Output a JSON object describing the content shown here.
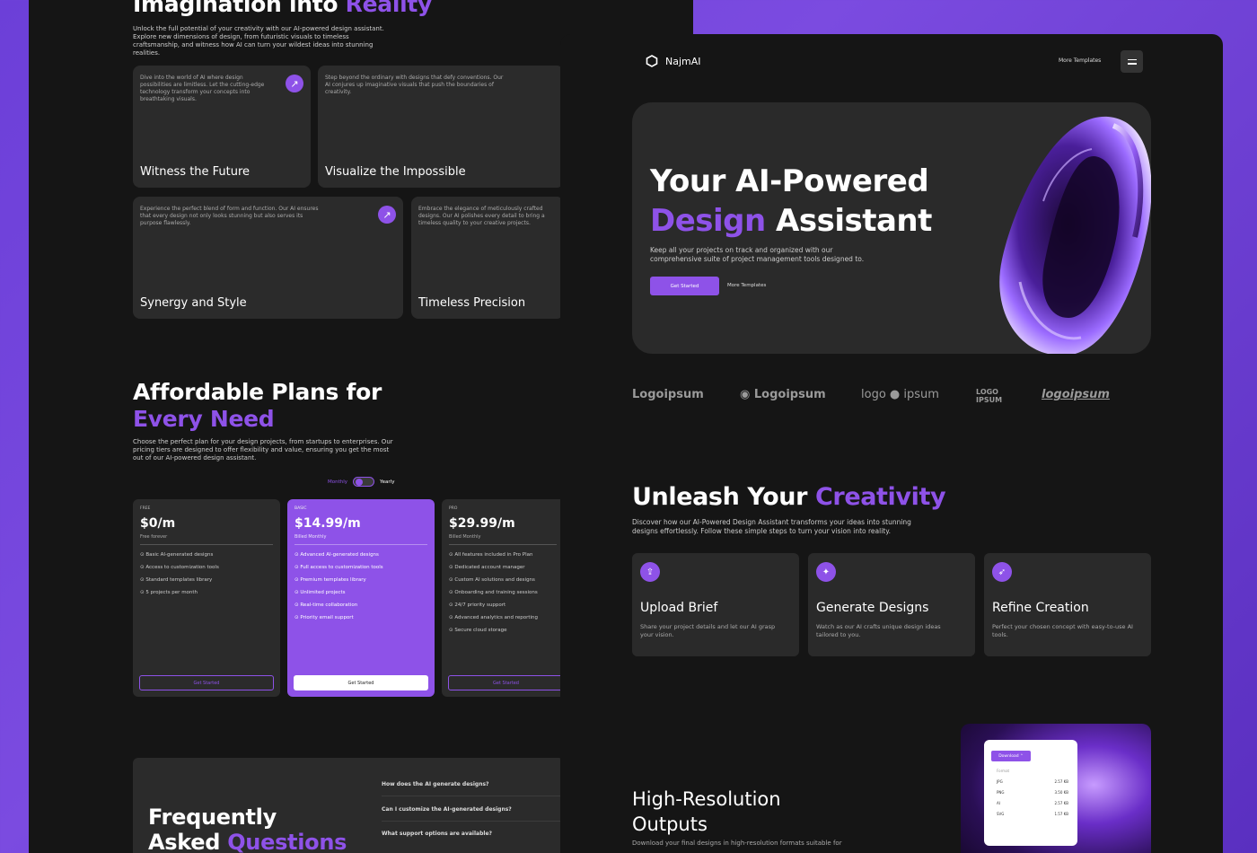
{
  "colors": {
    "accent": "#8e52e8",
    "background": "#151515",
    "card": "#2b2b2b"
  },
  "left": {
    "hero": {
      "title_a": "Imagination into ",
      "title_b": "Reality",
      "desc": "Unlock the full potential of your creativity with our AI-powered design assistant. Explore new dimensions of design, from futuristic visuals to timeless craftsmanship, and witness how AI can turn your wildest ideas into stunning realities."
    },
    "features": [
      {
        "title": "Witness the Future",
        "desc": "Dive into the world of AI where design possibilities are limitless. Let the cutting-edge technology transform your concepts into breathtaking visuals."
      },
      {
        "title": "Visualize the Impossible",
        "desc": "Step beyond the ordinary with designs that defy conventions. Our AI conjures up imaginative visuals that push the boundaries of creativity."
      },
      {
        "title": "Synergy and Style",
        "desc": "Experience the perfect blend of form and function. Our AI ensures that every design not only looks stunning but also serves its purpose flawlessly."
      },
      {
        "title": "Timeless Precision",
        "desc": "Embrace the elegance of meticulously crafted designs. Our AI polishes every detail to bring a timeless quality to your creative projects."
      }
    ],
    "plans": {
      "title_a": "Affordable Plans for",
      "title_b": "Every Need",
      "desc": "Choose the perfect plan for your design projects, from startups to enterprises. Our pricing tiers are designed to offer flexibility and value, ensuring you get the most out of our AI-powered design assistant.",
      "toggle_monthly": "Monthly",
      "toggle_yearly": "Yearly",
      "cards": [
        {
          "tier": "FREE",
          "price": "$0/m",
          "billing": "Free forever",
          "cta": "Get Started",
          "features": [
            "Basic AI-generated designs",
            "Access to customization tools",
            "Standard templates library",
            "5 projects per month"
          ]
        },
        {
          "tier": "BASIC",
          "price": "$14.99/m",
          "billing": "Billed Monthly",
          "cta": "Get Started",
          "features": [
            "Advanced AI-generated designs",
            "Full access to customization tools",
            "Premium templates library",
            "Unlimited projects",
            "Real-time collaboration",
            "Priority email support"
          ]
        },
        {
          "tier": "PRO",
          "price": "$29.99/m",
          "billing": "Billed Monthly",
          "cta": "Get Started",
          "features": [
            "All features included in Pro Plan",
            "Dedicated account manager",
            "Custom AI solutions and designs",
            "Onboarding and training sessions",
            "24/7 priority support",
            "Advanced analytics and reporting",
            "Secure cloud storage"
          ]
        }
      ]
    },
    "faq": {
      "title_a": "Frequently",
      "title_b": "Asked ",
      "title_c": "Questions",
      "questions": [
        "How does the AI generate designs?",
        "Can I customize the AI-generated designs?",
        "What support options are available?"
      ]
    }
  },
  "right": {
    "nav": {
      "brand": "NajmAI",
      "link": "More Templates"
    },
    "hero": {
      "line1": "Your AI-Powered",
      "line2_a": "Design",
      "line2_b": " Assistant",
      "sub": "Keep all your projects on track and organized with our comprehensive suite of project management tools designed to.",
      "cta_primary": "Get Started",
      "cta_secondary": "More Templates"
    },
    "logos": [
      "Logoipsum",
      "Logoipsum",
      "logo",
      "ipsum",
      "LOGO IPSUM",
      "logoipsum"
    ],
    "creativity": {
      "title_a": "Unleash Your ",
      "title_b": "Creativity",
      "desc": "Discover how our AI-Powered Design Assistant transforms your ideas into stunning designs effortlessly. Follow these simple steps to turn your vision into reality."
    },
    "steps": [
      {
        "icon": "upload-icon",
        "title": "Upload Brief",
        "desc": "Share your project details and let our AI grasp your vision."
      },
      {
        "icon": "sparkle-icon",
        "title": "Generate Designs",
        "desc": "Watch as our AI crafts unique design ideas tailored to you."
      },
      {
        "icon": "rocket-icon",
        "title": "Refine Creation",
        "desc": "Perfect your chosen concept with easy-to-use AI tools."
      }
    ],
    "outputs": {
      "title_a": "High-Resolution",
      "title_b": "Outputs",
      "desc": "Download your final designs in high-resolution formats suitable for",
      "download_label": "Download",
      "format_header": "Format",
      "formats": [
        {
          "name": "JPG",
          "size": "2.57 KB"
        },
        {
          "name": "PNG",
          "size": "3.50 KB"
        },
        {
          "name": "AI",
          "size": "2.57 KB"
        },
        {
          "name": "SVG",
          "size": "1.57 KB"
        }
      ]
    }
  }
}
